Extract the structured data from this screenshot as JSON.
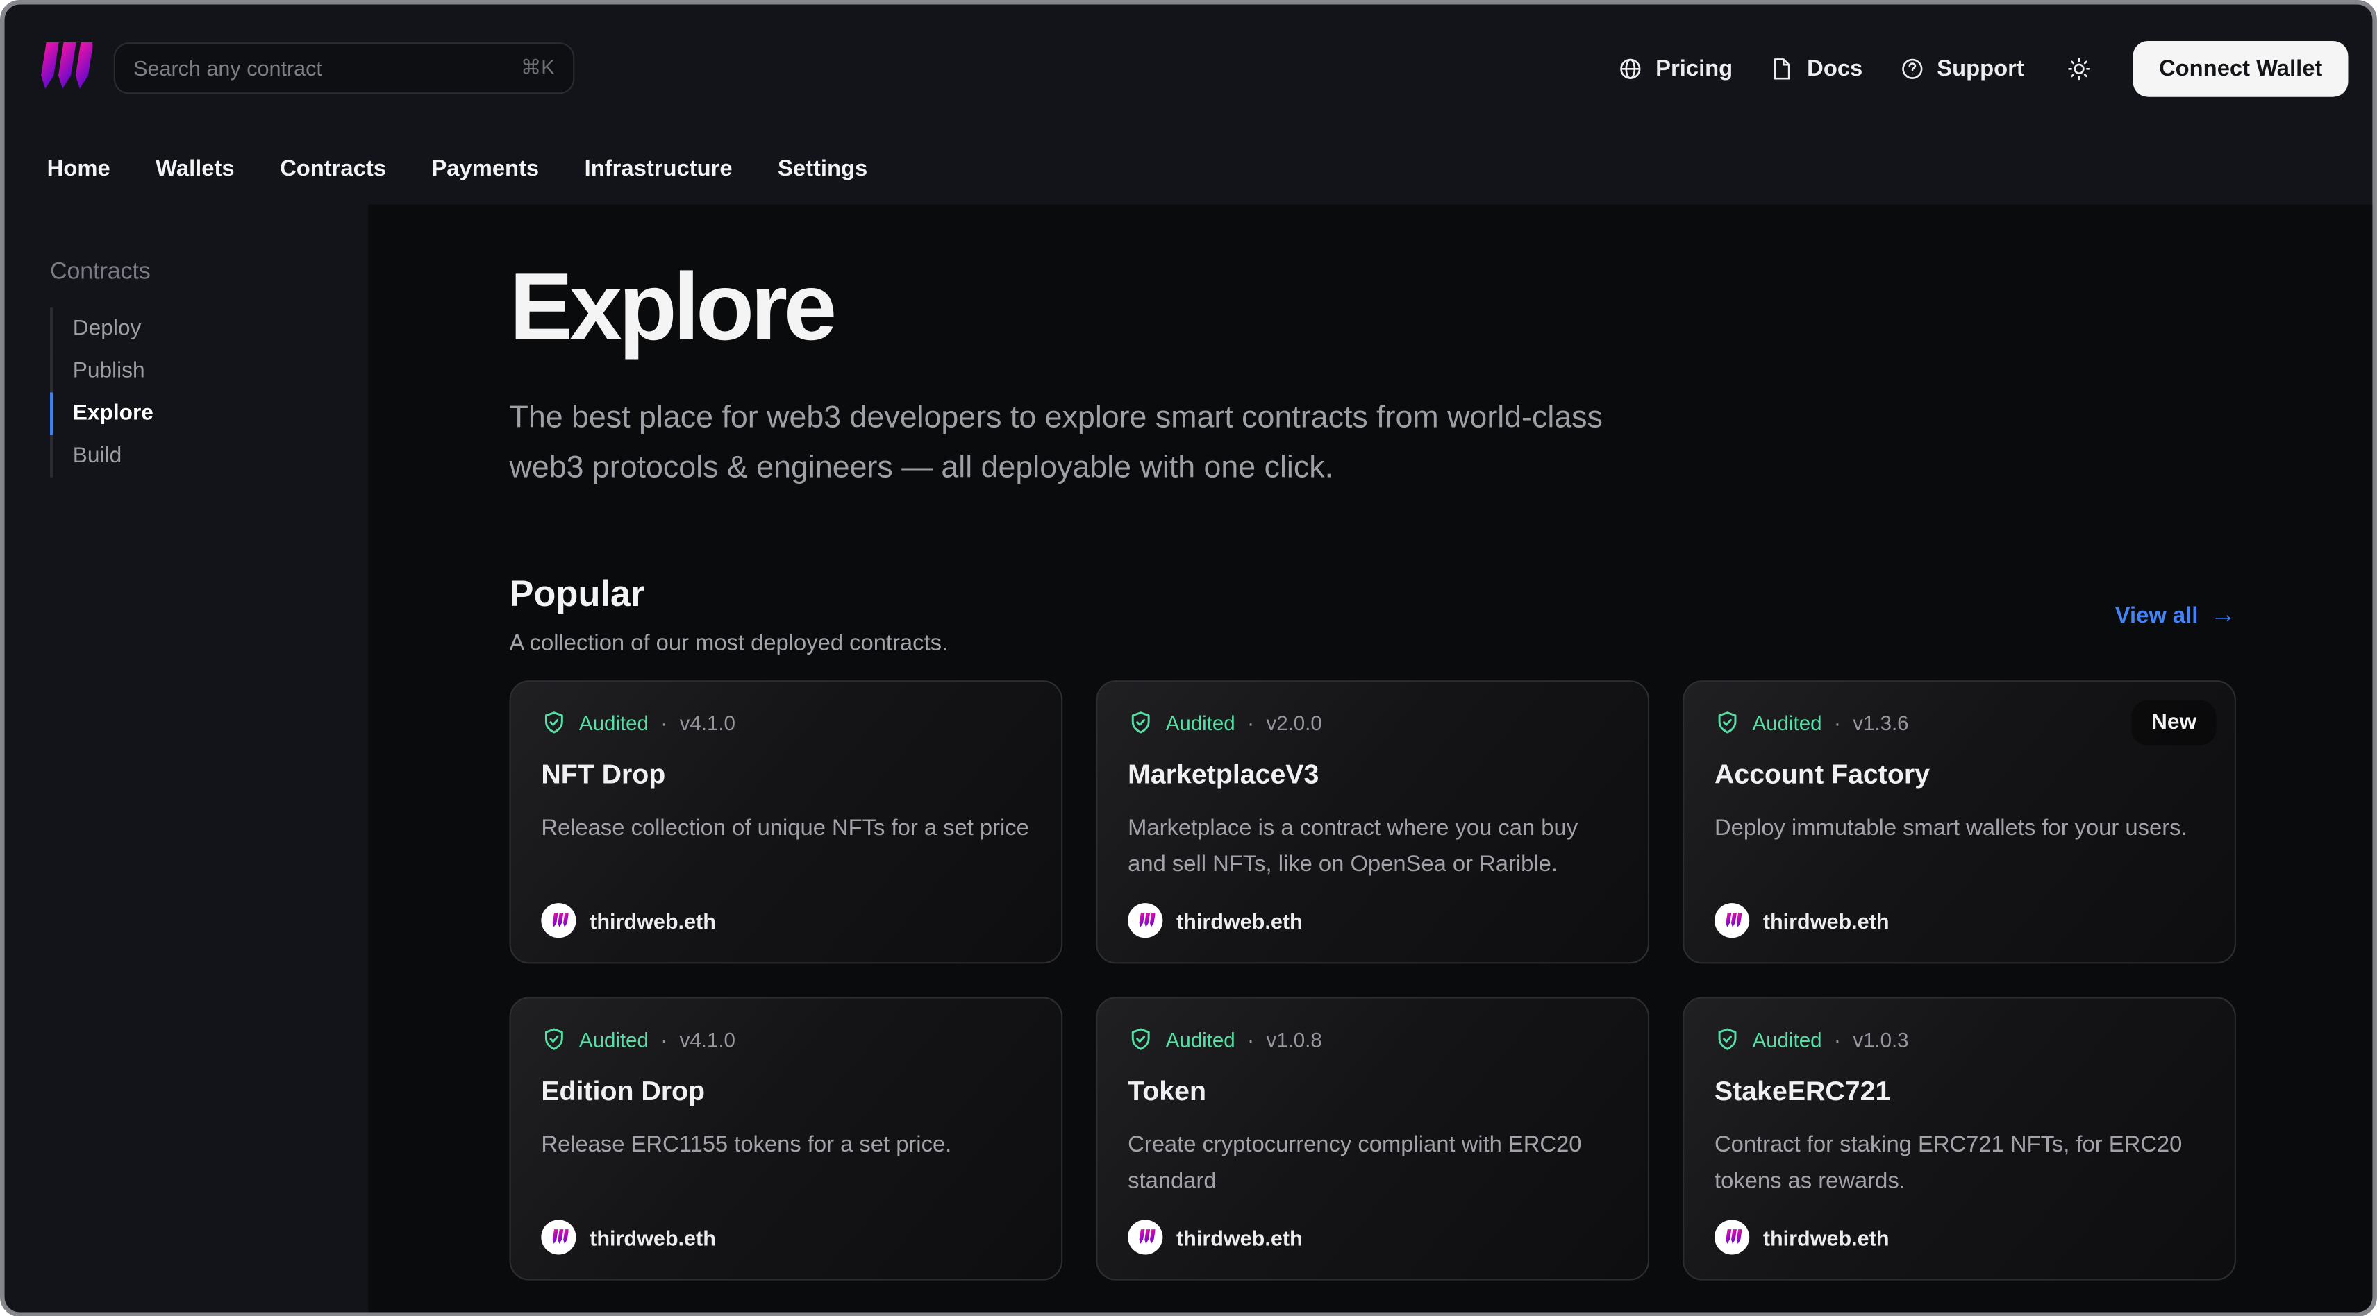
{
  "header": {
    "search": {
      "placeholder": "Search any contract",
      "shortcut": "⌘K"
    },
    "links": [
      {
        "label": "Pricing",
        "icon": "globe-icon"
      },
      {
        "label": "Docs",
        "icon": "document-icon"
      },
      {
        "label": "Support",
        "icon": "help-circle-icon"
      }
    ],
    "theme_toggle_icon": "sun-icon",
    "connect_wallet": "Connect Wallet"
  },
  "nav": {
    "items": [
      "Home",
      "Wallets",
      "Contracts",
      "Payments",
      "Infrastructure",
      "Settings"
    ]
  },
  "sidebar": {
    "section": "Contracts",
    "items": [
      {
        "label": "Deploy",
        "active": false
      },
      {
        "label": "Publish",
        "active": false
      },
      {
        "label": "Explore",
        "active": true
      },
      {
        "label": "Build",
        "active": false
      }
    ]
  },
  "hero": {
    "title": "Explore",
    "description": "The best place for web3 developers to explore smart contracts from world-class web3 protocols & engineers — all deployable with one click."
  },
  "popular": {
    "title": "Popular",
    "subtitle": "A collection of our most deployed contracts.",
    "view_all": "View all",
    "arrow": "→"
  },
  "cards_meta": {
    "audited": "Audited",
    "separator": "·",
    "publisher": "thirdweb.eth",
    "badge_icon": "shield-check-icon",
    "publisher_icon": "thirdweb-logo-icon"
  },
  "cards": [
    {
      "version": "v4.1.0",
      "title": "NFT Drop",
      "description": "Release collection of unique NFTs for a set price"
    },
    {
      "version": "v2.0.0",
      "title": "MarketplaceV3",
      "description": "Marketplace is a contract where you can buy and sell NFTs, like on OpenSea or Rarible."
    },
    {
      "version": "v1.3.6",
      "title": "Account Factory",
      "description": "Deploy immutable smart wallets for your users.",
      "badge": "New"
    },
    {
      "version": "v4.1.0",
      "title": "Edition Drop",
      "description": "Release ERC1155 tokens for a set price."
    },
    {
      "version": "v1.0.8",
      "title": "Token",
      "description": "Create cryptocurrency compliant with ERC20 standard"
    },
    {
      "version": "v1.0.3",
      "title": "StakeERC721",
      "description": "Contract for staking ERC721 NFTs, for ERC20 tokens as rewards."
    }
  ],
  "colors": {
    "accent_blue": "#3b82f6",
    "view_all_blue": "#4584f5",
    "audited_green": "#55e0a5",
    "brand_pink": "#f213a4",
    "brand_purple": "#5204bf"
  }
}
